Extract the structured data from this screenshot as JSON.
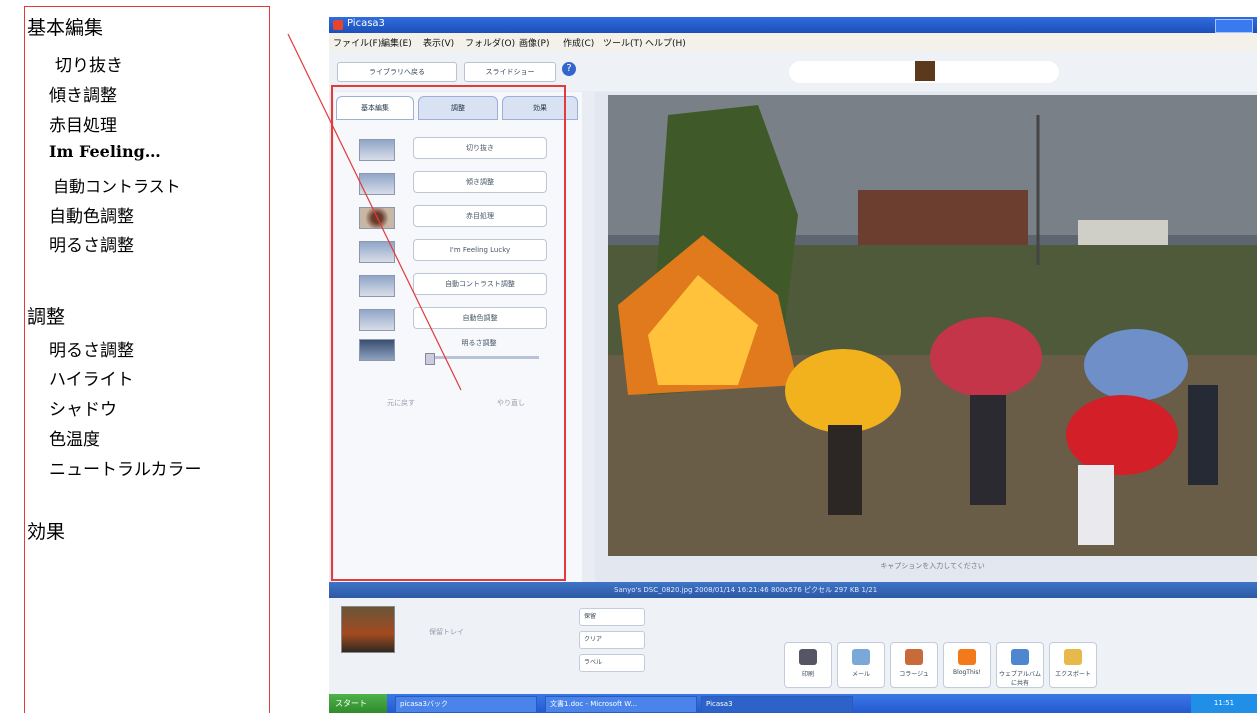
{
  "annotation": {
    "basic_title": "基本編集",
    "basic_items": [
      "切り抜き",
      "傾き調整",
      "赤目処理",
      "Im Feeling…",
      "自動コントラスト",
      "自動色調整",
      "明るさ調整"
    ],
    "adjust_title": "調整",
    "adjust_items": [
      "明るさ調整",
      "ハイライト",
      "シャドウ",
      "色温度",
      "ニュートラルカラー"
    ],
    "effects_title": "効果"
  },
  "app": {
    "title": "Picasa3",
    "menu": [
      "ファイル(F)",
      "編集(E)",
      "表示(V)",
      "フォルダ(O)",
      "画像(P)",
      "作成(C)",
      "ツール(T)",
      "ヘルプ(H)"
    ],
    "toolbar": {
      "back_label": "ライブラリへ戻る",
      "slideshow_label": "スライドショー",
      "help_label": "?"
    },
    "tabs": [
      "基本編集",
      "調整",
      "効果"
    ],
    "tools": [
      "切り抜き",
      "傾き調整",
      "赤目処理",
      "I'm Feeling Lucky",
      "自動コントラスト調整",
      "自動色調整",
      "明るさ調整"
    ],
    "undo_label": "元に戻す",
    "redo_label": "やり直し",
    "caption": "キャプションを入力してください",
    "info": "Sanyo's DSC_0820.jpg   2008/01/14 16:21:46   800x576 ピクセル   297 KB   1/21",
    "tray_text": "保留トレイ",
    "side_buttons": [
      "保留",
      "クリア",
      "ラベル"
    ],
    "action_buttons": [
      "印刷",
      "メール",
      "コラージュ",
      "BlogThis!",
      "ウェブアルバムに共有",
      "エクスポート"
    ],
    "colors": {
      "accent": "#2c59a6",
      "annotation_red": "#e23a3a",
      "titlebar": "#1c4fb8"
    },
    "taskbar": {
      "start": "スタート",
      "items": [
        "picasa3バック",
        "文書1.doc - Microsoft W...",
        "Picasa3"
      ],
      "clock": "11:51"
    }
  }
}
